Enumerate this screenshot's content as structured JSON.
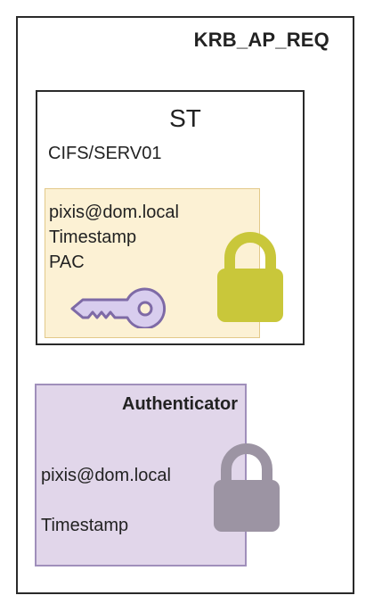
{
  "krb_ap_req": {
    "title": "KRB_AP_REQ",
    "service_ticket": {
      "title": "ST",
      "spn": "CIFS/SERV01",
      "fields": [
        "pixis@dom.local",
        "Timestamp",
        "PAC"
      ],
      "key_icon": "key-icon",
      "lock_icon": "padlock-icon",
      "lock_color": "#c9c73a",
      "fill_color": "#fcf1d4"
    },
    "authenticator": {
      "title": "Authenticator",
      "fields": [
        "pixis@dom.local",
        "Timestamp"
      ],
      "lock_icon": "padlock-icon",
      "lock_color": "#9c94a3",
      "fill_color": "#e1d6ea"
    }
  }
}
